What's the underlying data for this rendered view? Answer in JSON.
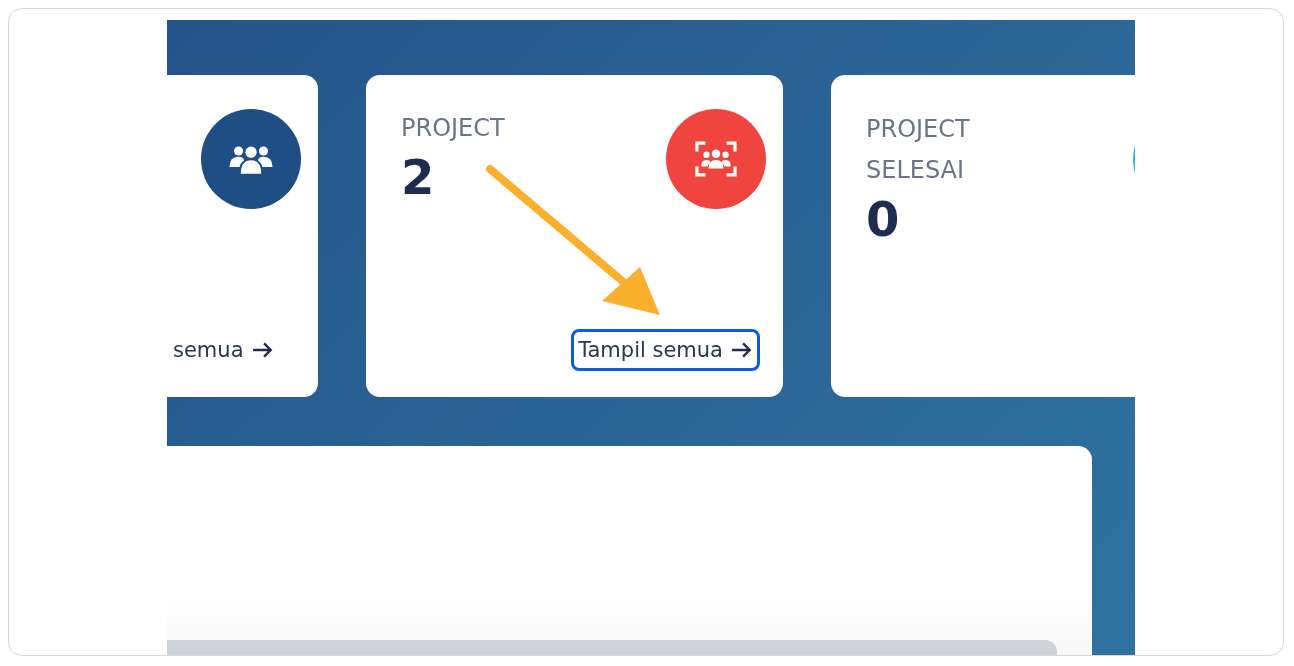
{
  "cards": [
    {
      "kind": "people",
      "color": "#1f4e85",
      "link": "semua",
      "highlighted": false
    },
    {
      "label": "PROJECT",
      "value": "2",
      "kind": "scan-people",
      "color": "#f0453e",
      "link": "Tampil semua",
      "highlighted": true
    },
    {
      "label": "PROJECT SELESAI",
      "value": "0",
      "kind": "circle",
      "color": "#22b8e8"
    }
  ]
}
